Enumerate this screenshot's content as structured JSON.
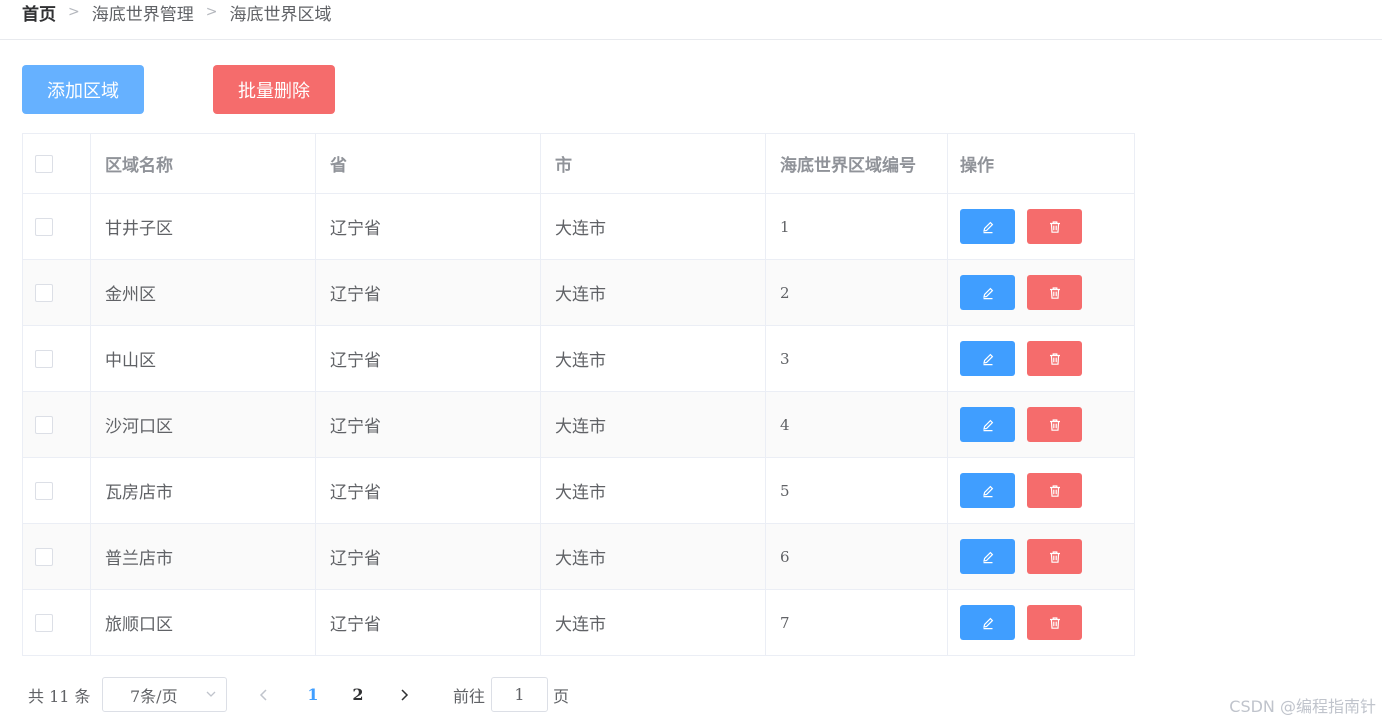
{
  "breadcrumb": {
    "home": "首页",
    "level1": "海底世界管理",
    "level2": "海底世界区域"
  },
  "toolbar": {
    "add_label": "添加区域",
    "batch_delete_label": "批量删除"
  },
  "table": {
    "columns": [
      "区域名称",
      "省",
      "市",
      "海底世界区域编号",
      "操作"
    ],
    "rows": [
      {
        "name": "甘井子区",
        "province": "辽宁省",
        "city": "大连市",
        "code": "1"
      },
      {
        "name": "金州区",
        "province": "辽宁省",
        "city": "大连市",
        "code": "2"
      },
      {
        "name": "中山区",
        "province": "辽宁省",
        "city": "大连市",
        "code": "3"
      },
      {
        "name": "沙河口区",
        "province": "辽宁省",
        "city": "大连市",
        "code": "4"
      },
      {
        "name": "瓦房店市",
        "province": "辽宁省",
        "city": "大连市",
        "code": "5"
      },
      {
        "name": "普兰店市",
        "province": "辽宁省",
        "city": "大连市",
        "code": "6"
      },
      {
        "name": "旅顺口区",
        "province": "辽宁省",
        "city": "大连市",
        "code": "7"
      }
    ]
  },
  "pagination": {
    "total": "共 11 条",
    "page_size": "7条/页",
    "pages": [
      "1",
      "2"
    ],
    "current_page": "1",
    "goto_prefix": "前往",
    "goto_value": "1",
    "goto_suffix": "页"
  },
  "watermark": "CSDN @编程指南针",
  "colors": {
    "primary": "#409eff",
    "primary_light": "#66b1ff",
    "danger": "#f56c6c"
  },
  "icons": {
    "edit": "edit-icon",
    "delete": "delete-icon",
    "separator": "chevron-right-icon"
  }
}
